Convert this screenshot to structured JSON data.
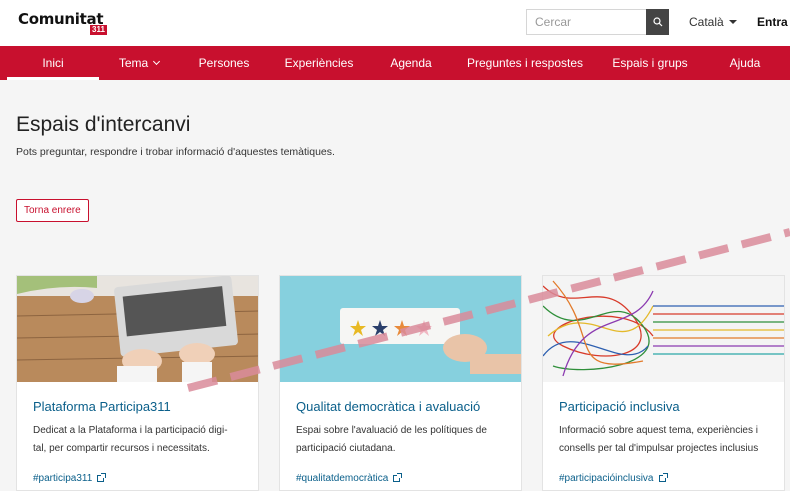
{
  "header": {
    "logo_word": "Comunitat",
    "logo_number": "311",
    "search_placeholder": "Cercar",
    "language": "Català",
    "login": "Entra"
  },
  "nav": {
    "items": [
      {
        "label": "Inici"
      },
      {
        "label": "Tema"
      },
      {
        "label": "Persones"
      },
      {
        "label": "Experiències"
      },
      {
        "label": "Agenda"
      },
      {
        "label": "Preguntes i respostes"
      },
      {
        "label": "Espais i grups"
      },
      {
        "label": "Ajuda"
      }
    ]
  },
  "page": {
    "title": "Espais d'intercanvi",
    "subtitle": "Pots preguntar, respondre i trobar informació d'aquestes temàtiques.",
    "back_button": "Torna enrere"
  },
  "cards": [
    {
      "title": "Plataforma Participa311",
      "desc_line1": "Dedicat a la Plataforma i la participació digi-",
      "desc_line2": "tal, per compartir recursos i necessitats.",
      "tag": "#participa311"
    },
    {
      "title": "Qualitat democràtica i avaluació",
      "desc_line1": "Espai sobre l'avaluació de les polítiques de",
      "desc_line2": "participació ciutadana.",
      "tag": "#qualitatdemocràtica"
    },
    {
      "title": "Participació inclusiva",
      "desc_line1": "Informació sobre aquest tema, experiències i",
      "desc_line2": "consells per tal d'impulsar projectes inclusius",
      "tag": "#participacióinclusiva"
    }
  ],
  "colors": {
    "brand_red": "#c8102e",
    "link_blue": "#0a5f8a"
  }
}
